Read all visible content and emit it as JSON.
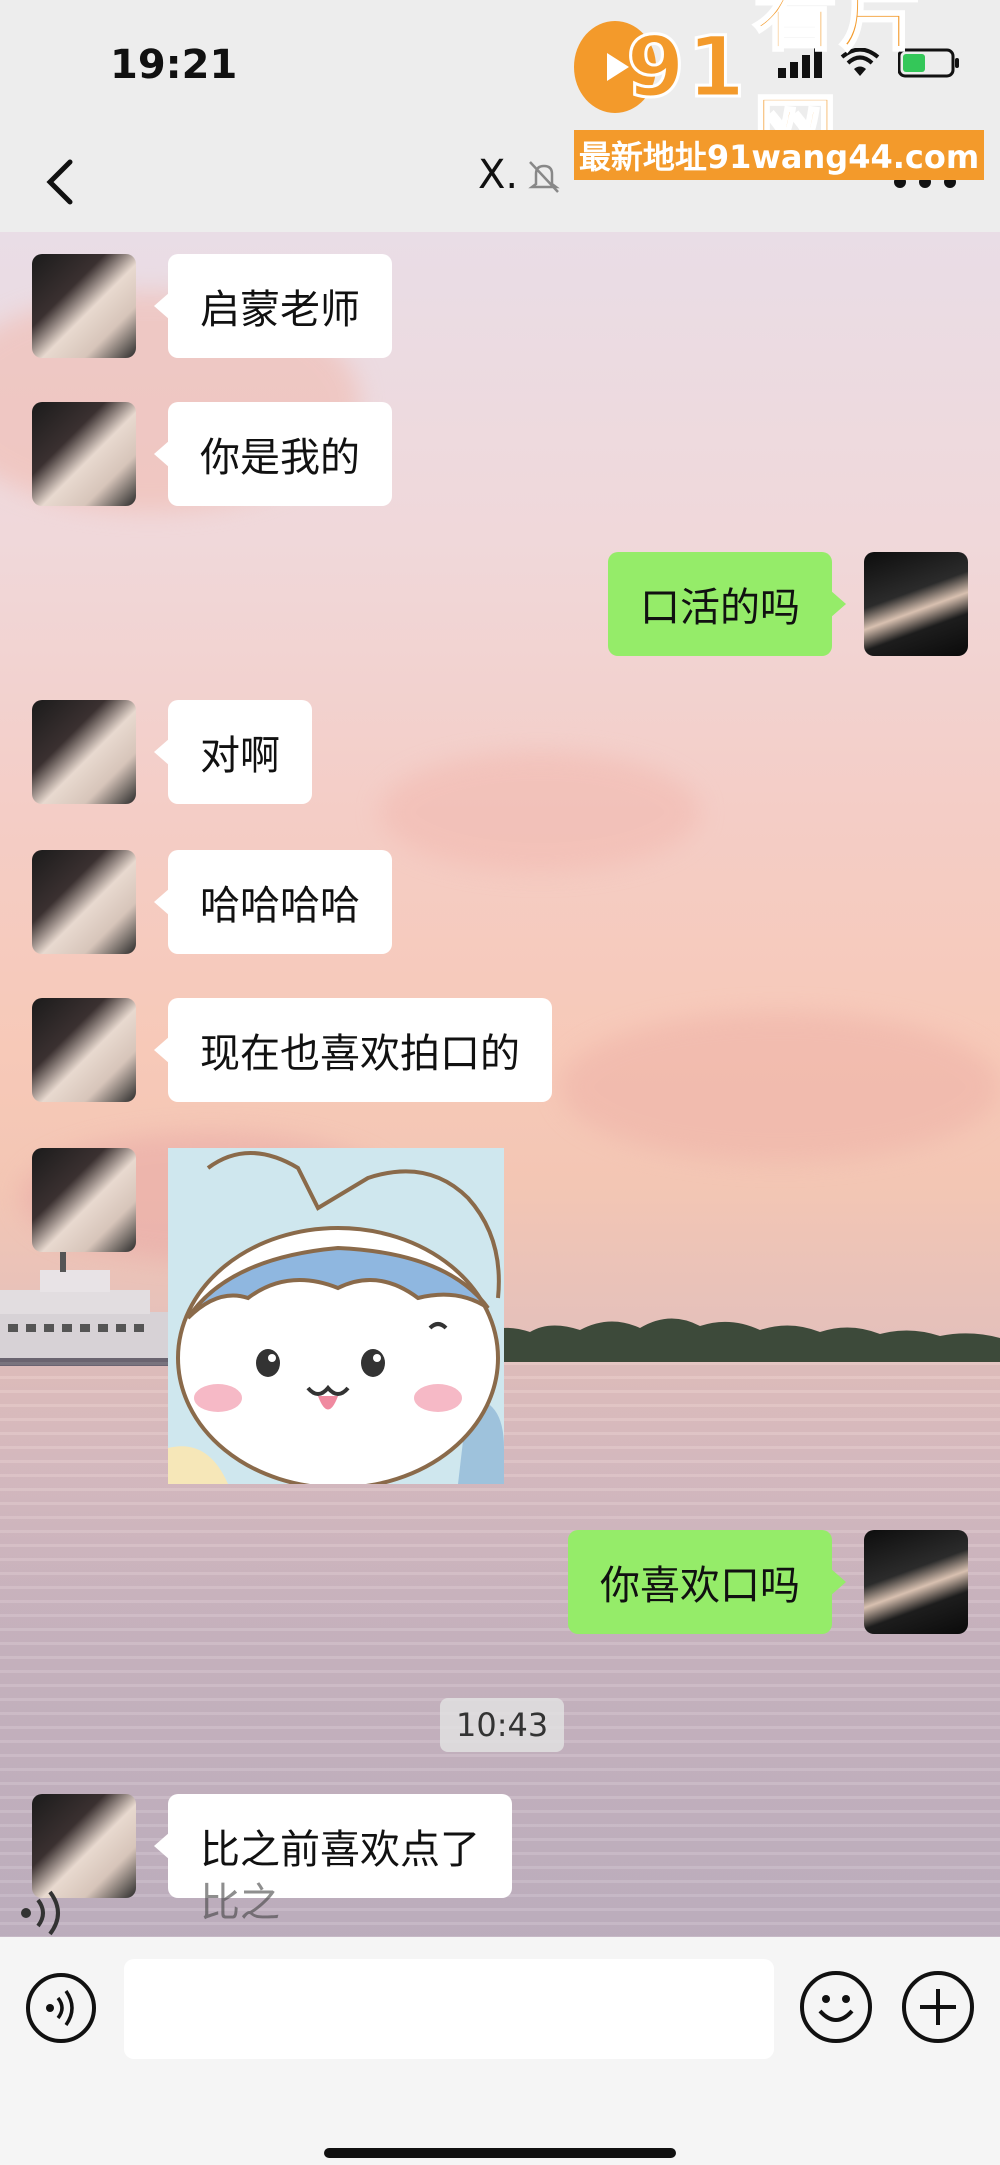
{
  "status_bar": {
    "time": "19:21"
  },
  "nav": {
    "title": "X."
  },
  "watermark": {
    "logo_text": "看片网",
    "logo_number": "91",
    "sub_text": "最新地址91wang44.com"
  },
  "messages": [
    {
      "side": "left",
      "text": "启蒙老师"
    },
    {
      "side": "left",
      "text": "你是我的"
    },
    {
      "side": "right",
      "text": "口活的吗"
    },
    {
      "side": "left",
      "text": "对啊"
    },
    {
      "side": "left",
      "text": "哈哈哈哈"
    },
    {
      "side": "left",
      "text": "现在也喜欢拍口的"
    },
    {
      "side": "left",
      "type": "sticker"
    },
    {
      "side": "right",
      "text": "你喜欢口吗"
    },
    {
      "side": "left",
      "text": "比之前喜欢点了"
    }
  ],
  "timestamp": "10:43",
  "overflow_text": "比之",
  "colors": {
    "self_bubble": "#95ec69",
    "other_bubble": "#ffffff",
    "bar": "#ededed",
    "watermark": "#f39a2b"
  }
}
